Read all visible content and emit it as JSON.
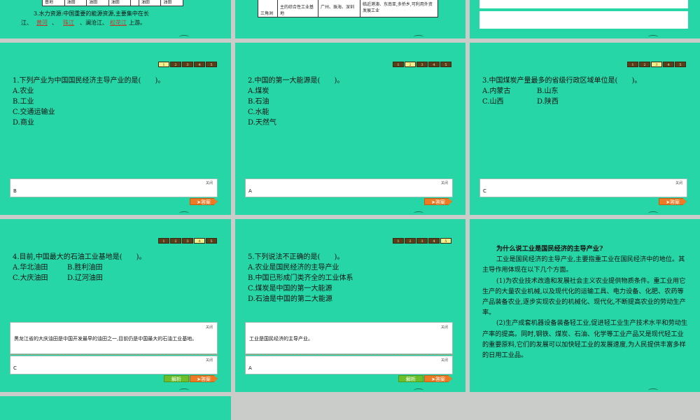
{
  "top_left": {
    "table_cells": [
      "基地",
      "油田",
      "油田",
      "油田",
      "",
      "油田",
      "油田"
    ],
    "water_text_1": "3.水力资源:中国重要的能源资源,主要集中在长",
    "water_text_2_pre": "江、",
    "fill_1": "黄河",
    "sep_1": "、",
    "fill_2": "珠江",
    "sep_2": "、澜沧江、",
    "fill_3": "松花江",
    "water_text_2_post": "上游。"
  },
  "top_mid": {
    "cell_a": "三角洲",
    "cell_b": "主的综合性工业基地",
    "cell_c": "广州、珠海、深圳",
    "cell_d": "临近港澳、东南亚,多侨乡,可利用外资发展工业"
  },
  "pagination": [
    "1",
    "2",
    "3",
    "4",
    "5"
  ],
  "close_label": "关闭",
  "answer_button": "答案",
  "explain_button": "解析",
  "q1": {
    "stem": "1.下列产业为中国国民经济主导产业的是(　　)。",
    "options": [
      "A.农业",
      "B.工业",
      "C.交通运输业",
      "D.商业"
    ],
    "answer": "B"
  },
  "q2": {
    "stem": "2.中国的第一大能源是(　　)。",
    "options": [
      "A.煤炭",
      "B.石油",
      "C.水能",
      "D.天然气"
    ],
    "answer": "A"
  },
  "q3": {
    "stem": "3.中国煤炭产量最多的省级行政区域单位是(　　)。",
    "options": [
      "A.内蒙古",
      "B.山东",
      "C.山西",
      "D.陕西"
    ],
    "answer": "C"
  },
  "q4": {
    "stem": "4.目前,中国最大的石油工业基地是(　　)。",
    "options": [
      "A.华北油田",
      "B.胜利油田",
      "C.大庆油田",
      "D.辽河油田"
    ],
    "explanation": "黑龙江省的大庆油田是中国开发最早的油田之一,目前仍是中国最大的石油工业基地。",
    "answer": "C"
  },
  "q5": {
    "stem": "5.下列说法不正确的是(　　)。",
    "options": [
      "A.农业是国民经济的主导产业",
      "B.中国已形成门类齐全的工业体系",
      "C.煤炭是中国的第一大能源",
      "D.石油是中国的第二大能源"
    ],
    "explanation": "工业是国民经济的主导产业。",
    "answer": "A"
  },
  "essay": {
    "title": "为什么说工业是国民经济的主导产业?",
    "paragraphs": [
      "工业是国民经济的主导产业,主要指重工业在国民经济中的地位。其主导作用体现在以下几个方面。",
      "(1)为农业技术改造和发展社会主义农业提供物质条件。重工业用它生产的大量农业机械,以及现代化的运输工具、电力设备、化肥、农药等产品装备农业,逐步实现农业的机械化、现代化,不断提高农业的劳动生产率。",
      "(2)生产成套机器设备装备轻工业,促进轻工业生产技术水平和劳动生产率的提高。同时,钢铁、煤炭、石油、化学等工业产品又是现代轻工业的重要原料,它们的发展可以加快轻工业的发展速度,为人民提供丰富多样的日用工业品。"
    ]
  }
}
